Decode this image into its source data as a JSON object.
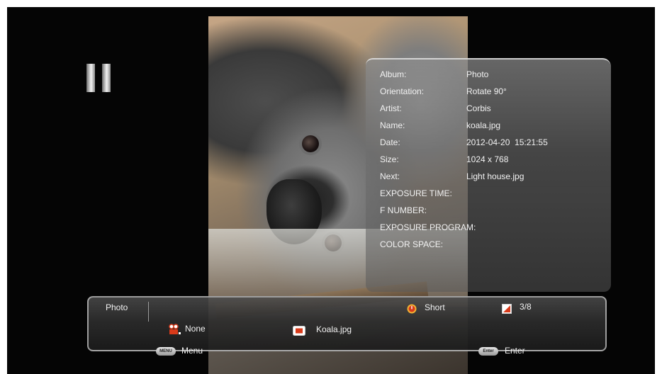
{
  "info": {
    "album_label": "Album:",
    "album_value": "Photo",
    "orientation_label": "Orientation:",
    "orientation_value": "Rotate 90°",
    "artist_label": "Artist:",
    "artist_value": "Corbis",
    "name_label": "Name:",
    "name_value": "koala.jpg",
    "date_label": "Date:",
    "date_value": "2012-04-20  15:21:55",
    "size_label": "Size:",
    "size_value": "1024 x 768",
    "next_label": "Next:",
    "next_value": "Light house.jpg",
    "exposure_time_label": "EXPOSURE TIME:",
    "f_number_label": "F NUMBER:",
    "exposure_program_label": "EXPOSURE PROGRAM:",
    "color_space_label": "COLOR SPACE:"
  },
  "bottom_bar": {
    "mode_label": "Photo",
    "interval_label": "Short",
    "counter_label": "3/8",
    "transition_label": "None",
    "filename_label": "Koala.jpg"
  },
  "hints": {
    "menu_key": "MENU",
    "menu_label": "Menu",
    "enter_key": "Enter",
    "enter_label": "Enter"
  },
  "icons": {
    "pause": "pause-icon",
    "transition": "slideshow-effect-icon",
    "file": "photo-file-icon",
    "interval": "timer-icon",
    "counter": "page-counter-icon"
  },
  "colors": {
    "background": "#050505",
    "accent_red": "#d83a1a",
    "text": "#f2f2f2"
  }
}
